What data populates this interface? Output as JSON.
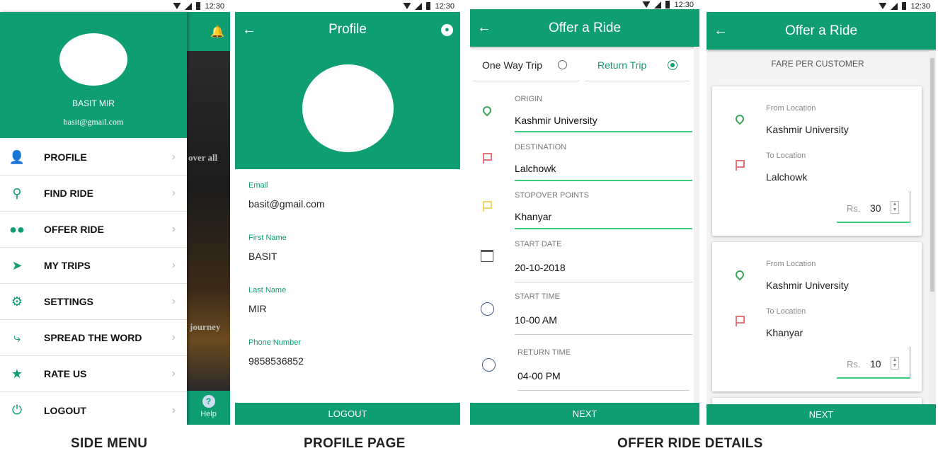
{
  "status": {
    "time": "12:30"
  },
  "side_menu": {
    "user_name": "BASIT MIR",
    "user_email": "basit@gmail.com",
    "items": [
      {
        "label": "PROFILE",
        "icon": "person-icon"
      },
      {
        "label": "FIND RIDE",
        "icon": "search-icon"
      },
      {
        "label": "OFFER RIDE",
        "icon": "group-icon"
      },
      {
        "label": "MY TRIPS",
        "icon": "navigation-icon"
      },
      {
        "label": "SETTINGS",
        "icon": "gear-icon"
      },
      {
        "label": "SPREAD THE WORD",
        "icon": "share-icon"
      },
      {
        "label": "RATE US",
        "icon": "star-icon"
      },
      {
        "label": "LOGOUT",
        "icon": "power-icon"
      }
    ],
    "behind_text_1": "over all",
    "behind_text_2": "journey",
    "help_label": "Help"
  },
  "profile": {
    "title": "Profile",
    "fields": [
      {
        "label": "Email",
        "value": "basit@gmail.com"
      },
      {
        "label": "First Name",
        "value": "BASIT"
      },
      {
        "label": "Last Name",
        "value": "MIR"
      },
      {
        "label": "Phone Number",
        "value": "9858536852"
      }
    ],
    "logout_label": "LOGOUT"
  },
  "offer_ride": {
    "title": "Offer a Ride",
    "trip_options": [
      "One Way Trip",
      "Return Trip"
    ],
    "selected_trip": "Return Trip",
    "origin_label": "ORIGIN",
    "origin_value": "Kashmir University",
    "destination_label": "DESTINATION",
    "destination_value": "Lalchowk",
    "stopover_label": "STOPOVER POINTS",
    "stopover_value": "Khanyar",
    "start_date_label": "START DATE",
    "start_date_value": "20-10-2018",
    "start_time_label": "START TIME",
    "start_time_value": "10-00 AM",
    "return_time_label": "RETURN TIME",
    "return_time_value": "04-00 PM",
    "next_label": "NEXT"
  },
  "fare": {
    "title": "Offer a Ride",
    "heading": "FARE PER CUSTOMER",
    "from_label": "From Location",
    "to_label": "To Location",
    "currency": "Rs.",
    "cards": [
      {
        "from": "Kashmir University",
        "to": "Lalchowk",
        "fare": "30"
      },
      {
        "from": "Kashmir University",
        "to": "Khanyar",
        "fare": "10"
      }
    ],
    "next_label": "NEXT"
  },
  "captions": {
    "side_menu": "SIDE MENU",
    "profile_page": "PROFILE PAGE",
    "offer_ride_details": "OFFER RIDE DETAILS"
  },
  "colors": {
    "primary": "#0f9d72",
    "origin_pin": "#3aa35a",
    "destination_flag": "#e8737a",
    "stopover_flag": "#f2d66b"
  }
}
